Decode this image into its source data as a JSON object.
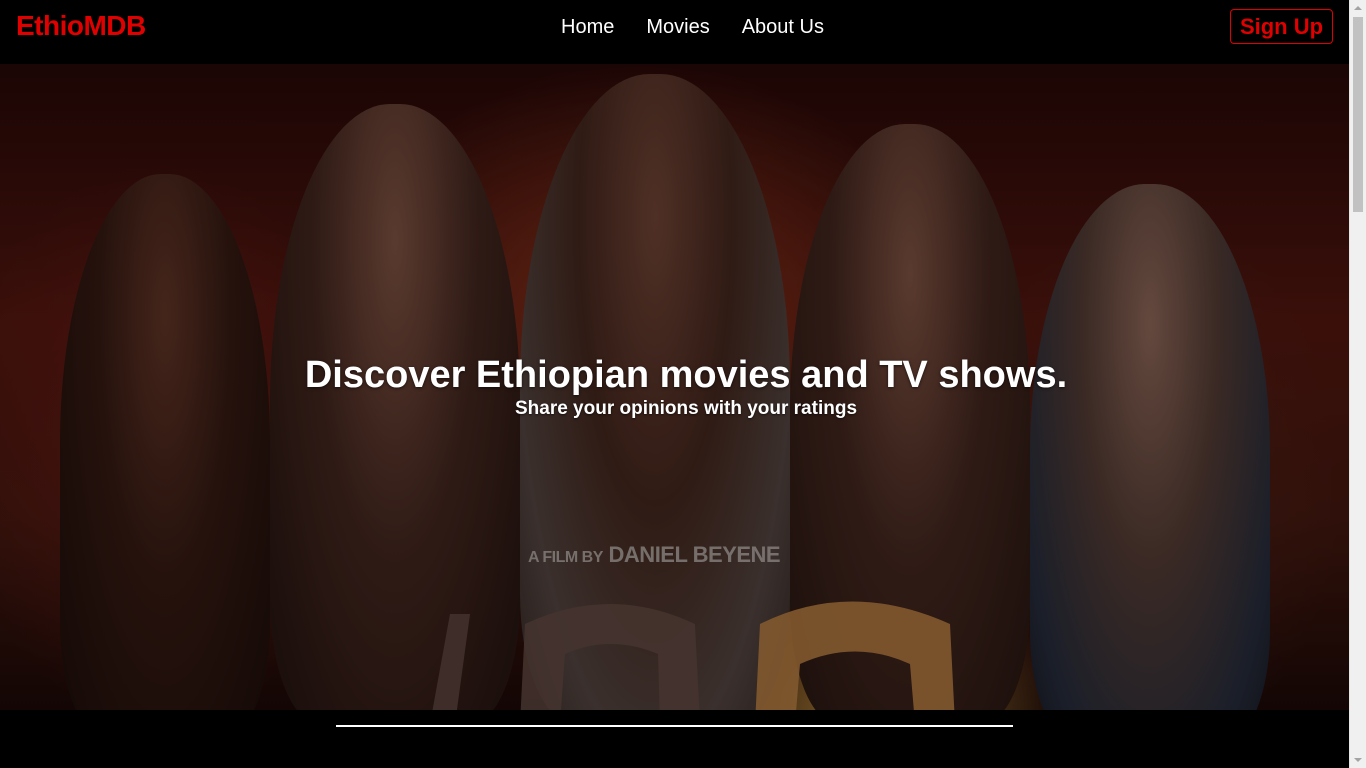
{
  "brand": {
    "name": "EthioMDB",
    "color": "#e00000"
  },
  "nav": {
    "links": [
      {
        "label": "Home"
      },
      {
        "label": "Movies"
      },
      {
        "label": "About Us"
      }
    ],
    "signup_label": "Sign Up"
  },
  "hero": {
    "headline": "Discover Ethiopian movies and TV shows.",
    "subline": "Share your opinions with your ratings",
    "poster_credit_prefix": "A FILM BY",
    "poster_credit_name": "DANIEL BEYENE"
  },
  "colors": {
    "accent": "#e00000",
    "navbar_bg": "#000000",
    "text": "#ffffff"
  },
  "icons": {
    "scroll_up": "triangle-up-icon",
    "scroll_down": "triangle-down-icon"
  }
}
